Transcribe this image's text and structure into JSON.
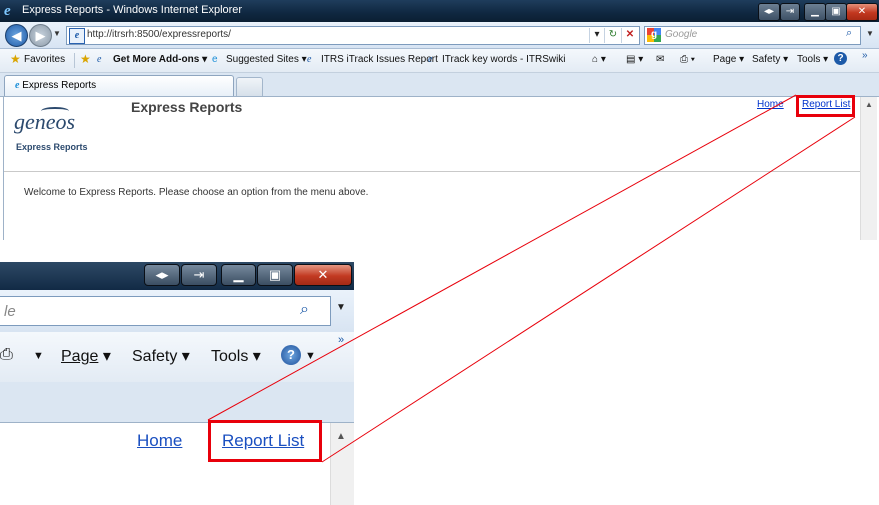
{
  "window": {
    "title": "Express Reports - Windows Internet Explorer",
    "icon": "ie-logo-icon"
  },
  "address_bar": {
    "url": "http://itrsrh:8500/expressreports/",
    "search_placeholder": "Google"
  },
  "favorites_bar": {
    "favorites_label": "Favorites",
    "items": [
      {
        "label": "Get More Add-ons ▾"
      },
      {
        "label": "Suggested Sites ▾"
      },
      {
        "label": "ITRS iTrack Issues Report"
      },
      {
        "label": "ITrack key words - ITRSwiki"
      }
    ]
  },
  "command_bar": {
    "page_label": "Page",
    "safety_label": "Safety",
    "tools_label": "Tools"
  },
  "tab": {
    "label": "Express Reports"
  },
  "page": {
    "logo_text": "geneos",
    "logo_subtitle": "Express Reports",
    "title": "Express Reports",
    "nav_home": "Home",
    "nav_report_list": "Report List",
    "welcome": "Welcome to Express Reports. Please choose an option from the menu above."
  },
  "zoom": {
    "search_fragment": "le",
    "page_label": "Page",
    "safety_label": "Safety",
    "tools_label": "Tools",
    "home": "Home",
    "report_list": "Report List",
    "overflow_chevron": "»"
  },
  "colors": {
    "highlight": "#e8000b",
    "link": "#0033cc",
    "title_bar": "#122a45"
  }
}
